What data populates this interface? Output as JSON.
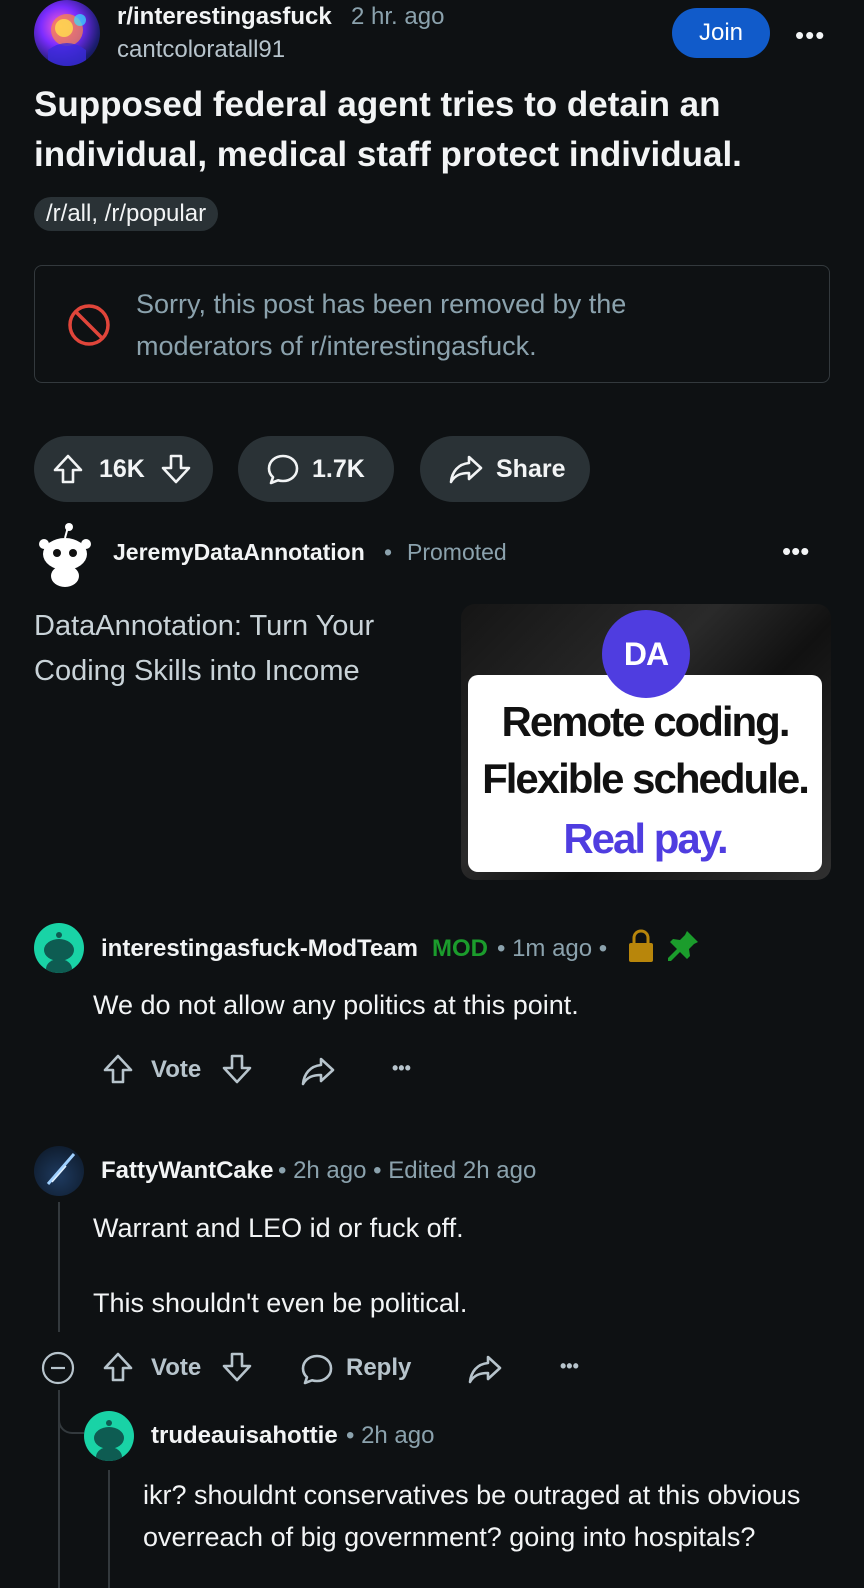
{
  "post": {
    "subreddit": "r/interestingasfuck",
    "time": "2 hr. ago",
    "author": "cantcoloratall91",
    "join_label": "Join",
    "more_label": "•••",
    "title": "Supposed federal agent tries to detain an individual, medical staff protect individual.",
    "flair": "/r/all, /r/popular",
    "removed_notice": "Sorry, this post has been removed by the moderators of r/interestingasfuck.",
    "votes": "16K",
    "comments": "1.7K",
    "share_label": "Share"
  },
  "promoted": {
    "author": "JeremyDataAnnotation",
    "separator": "•",
    "tag": "Promoted",
    "more_label": "•••",
    "headline": "DataAnnotation: Turn Your Coding Skills into Income",
    "ad_logo": "DA",
    "ad_line1": "Remote coding.",
    "ad_line2": "Flexible schedule.",
    "ad_line3": "Real pay."
  },
  "comments": [
    {
      "author": "interestingasfuck-ModTeam",
      "badge": "MOD",
      "meta": "• 1m ago •",
      "body": "We do not allow any politics at this point.",
      "vote_label": "Vote",
      "more_label": "•••"
    },
    {
      "author": "FattyWantCake",
      "meta": "• 2h ago • Edited 2h ago",
      "body_line1": "Warrant and LEO id or fuck off.",
      "body_line2": "This shouldn't even be political.",
      "vote_label": "Vote",
      "reply_label": "Reply",
      "more_label": "•••"
    },
    {
      "author": "trudeauisahottie",
      "meta": "• 2h ago",
      "body": "ikr? shouldnt conservatives be outraged at this obvious overreach of big government? going into hospitals?"
    }
  ],
  "colors": {
    "background": "#0e1113",
    "join_button": "#115bca",
    "mod_badge": "#1b9c2c",
    "ban_icon": "#e0453a",
    "lock_icon": "#b8860b",
    "pin_icon": "#1b9c2c",
    "ad_accent": "#4f3de0"
  }
}
